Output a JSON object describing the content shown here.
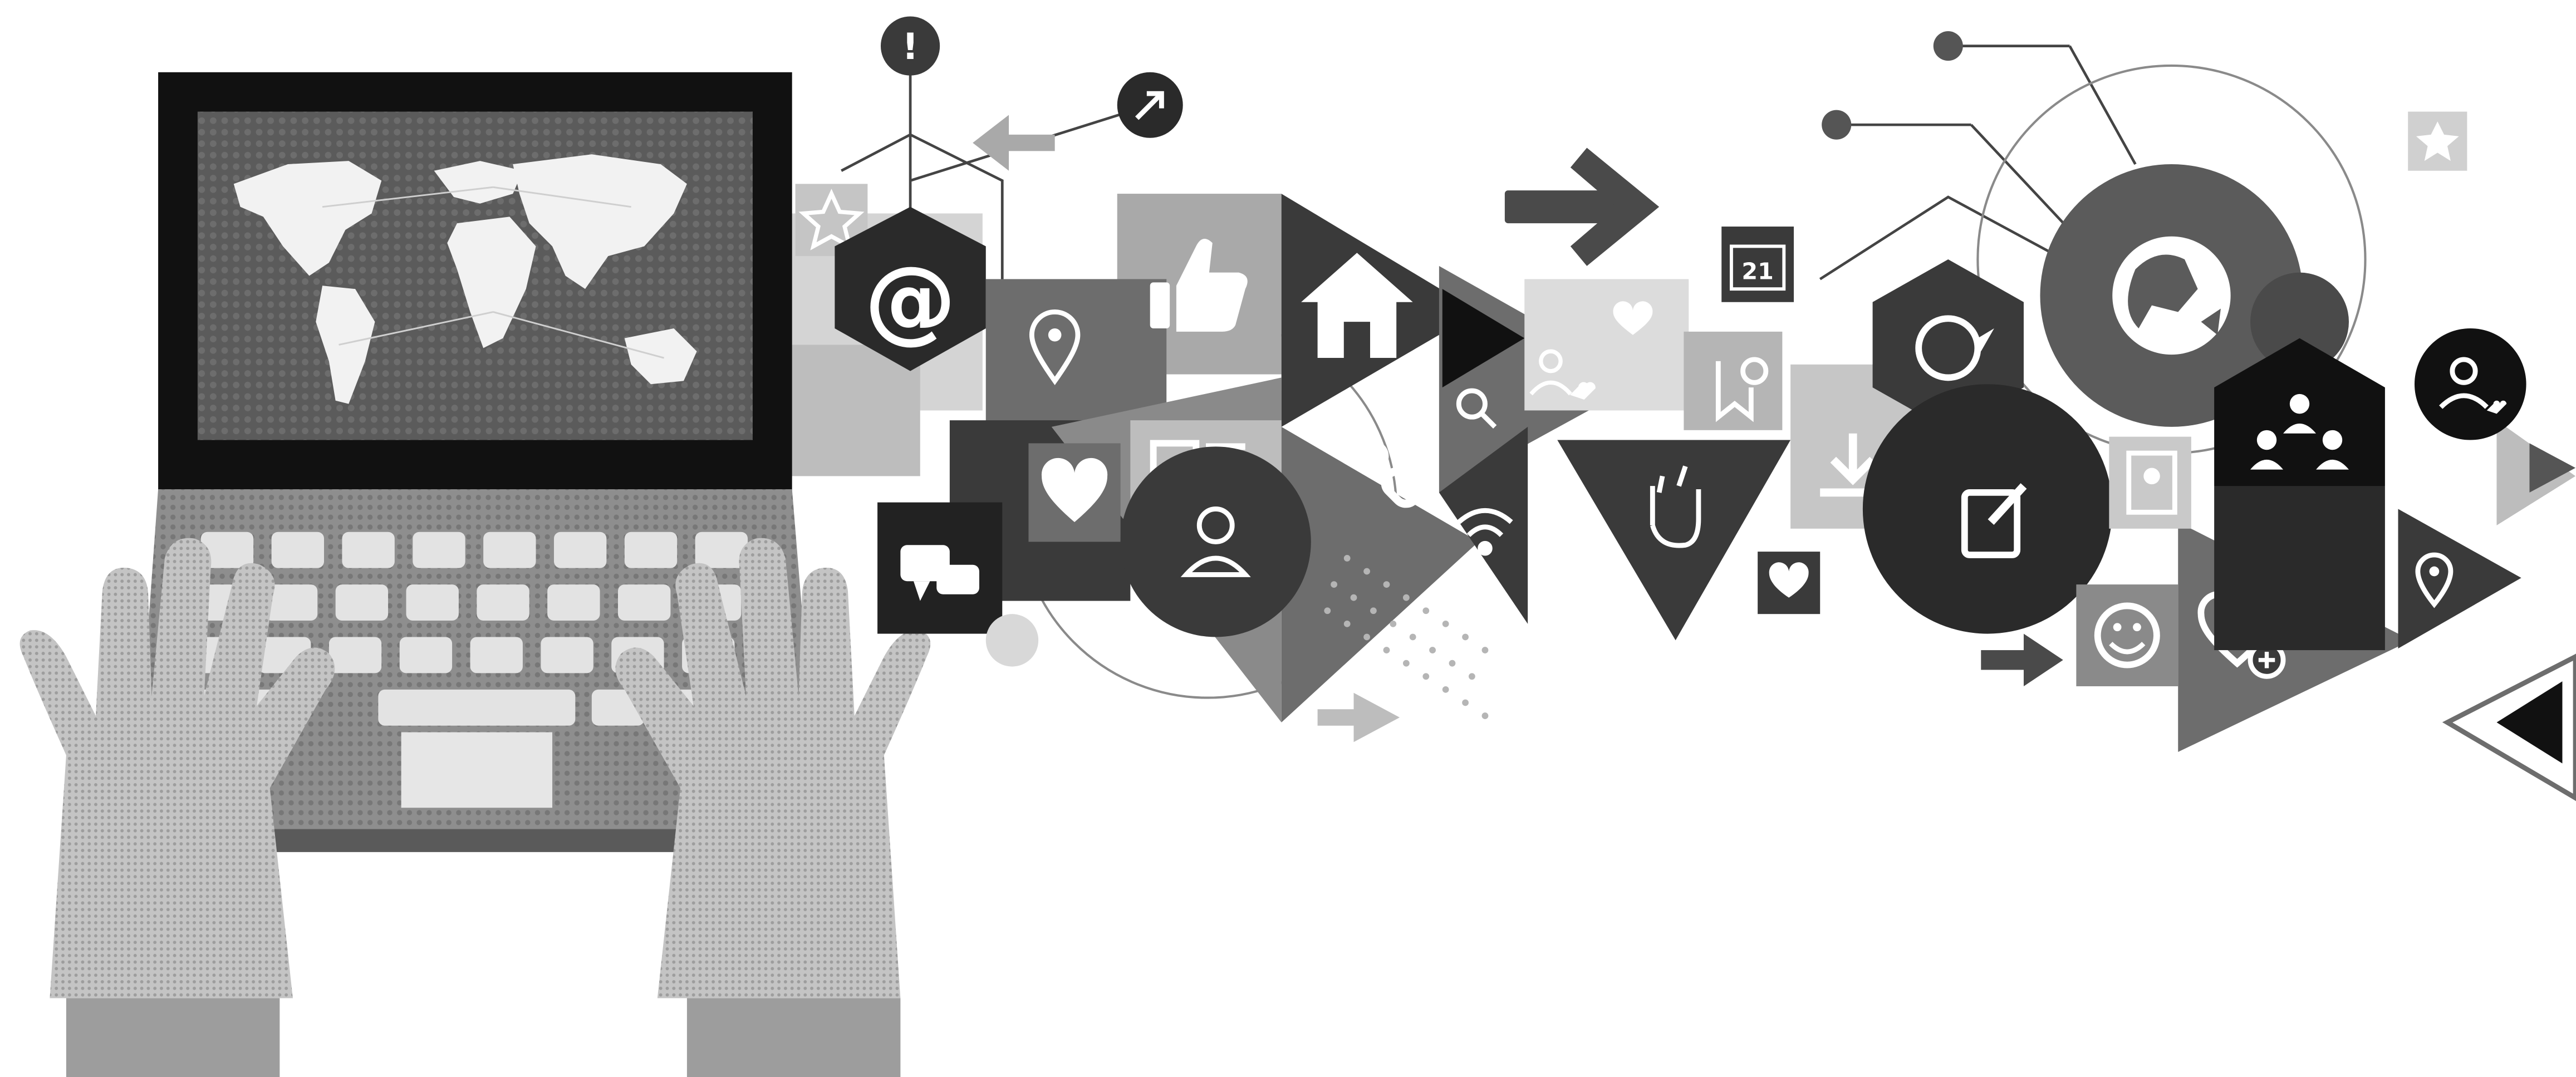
{
  "illustration": {
    "email_symbol": "@",
    "alert_symbol": "!",
    "calendar_day": "21"
  },
  "palette": {
    "black": "#111111",
    "dark": "#3a3a3a",
    "mid": "#6d6d6d",
    "light": "#a9a9a9",
    "pale": "#d4d4d4",
    "white": "#ffffff"
  },
  "icons": [
    "world-map-icon",
    "email-icon",
    "alert-icon",
    "share-arrow-icon",
    "star-icon",
    "location-pin-icon",
    "thumbs-up-icon",
    "home-icon",
    "search-icon",
    "link-icon",
    "wifi-icon",
    "heart-icon",
    "user-icon",
    "chat-icon",
    "news-icon",
    "user-heart-icon",
    "calendar-icon",
    "bookmark-add-icon",
    "rock-hand-icon",
    "download-icon",
    "bird-icon",
    "globe-icon",
    "edit-note-icon",
    "contacts-icon",
    "smiley-icon",
    "heart-add-icon",
    "network-group-icon",
    "arrow-right-icon",
    "arrow-left-icon"
  ]
}
